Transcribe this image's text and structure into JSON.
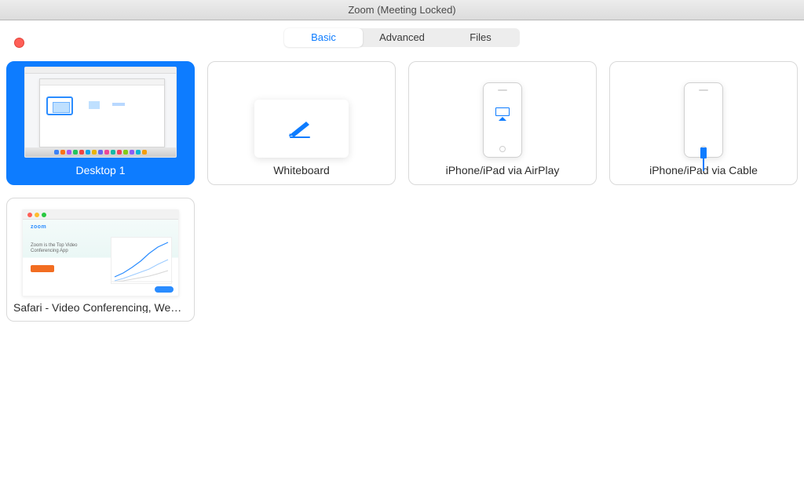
{
  "window": {
    "title": "Zoom (Meeting Locked)"
  },
  "tabs": {
    "basic": "Basic",
    "advanced": "Advanced",
    "files": "Files"
  },
  "options": {
    "desktop1": "Desktop 1",
    "whiteboard": "Whiteboard",
    "airplay": "iPhone/iPad via AirPlay",
    "cable": "iPhone/iPad via Cable",
    "safari": "Safari - Video Conferencing, Web Conferencing, Webinars"
  },
  "safari_preview": {
    "logo": "zoom",
    "headline": "Zoom is the Top Video Conferencing App"
  },
  "dock_colors": [
    "#3b82f6",
    "#f97316",
    "#a855f7",
    "#22c55e",
    "#ef4444",
    "#0ea5e9",
    "#eab308",
    "#6366f1",
    "#ec4899",
    "#14b8a6",
    "#f43f5e",
    "#84cc16",
    "#8b5cf6",
    "#06b6d4",
    "#f59e0b"
  ]
}
